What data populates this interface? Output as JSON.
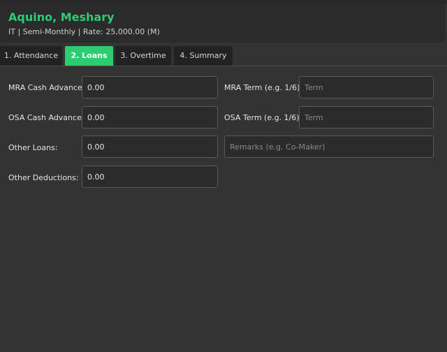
{
  "header": {
    "employee_name": "Aquino, Meshary",
    "subtitle": "IT | Semi-Monthly | Rate: 25,000.00 (M)"
  },
  "tabs": [
    {
      "label": "1. Attendance",
      "active": false
    },
    {
      "label": "2. Loans",
      "active": true
    },
    {
      "label": "3. Overtime",
      "active": false
    },
    {
      "label": "4. Summary",
      "active": false
    }
  ],
  "loans": {
    "mra_cash_advance": {
      "label": "MRA Cash Advance:",
      "value": "0.00"
    },
    "mra_term": {
      "label": "MRA Term (e.g. 1/6):",
      "placeholder": "Term",
      "value": ""
    },
    "osa_cash_advance": {
      "label": "OSA Cash Advance:",
      "value": "0.00"
    },
    "osa_term": {
      "label": "OSA Term (e.g. 1/6):",
      "placeholder": "Term",
      "value": ""
    },
    "other_loans": {
      "label": "Other Loans:",
      "value": "0.00"
    },
    "remarks": {
      "placeholder": "Remarks (e.g. Co-Maker)",
      "value": ""
    },
    "other_deductions": {
      "label": "Other Deductions:",
      "value": "0.00"
    }
  },
  "colors": {
    "accent": "#2ecc71",
    "background": "#333333",
    "panel": "#2b2b2b"
  }
}
